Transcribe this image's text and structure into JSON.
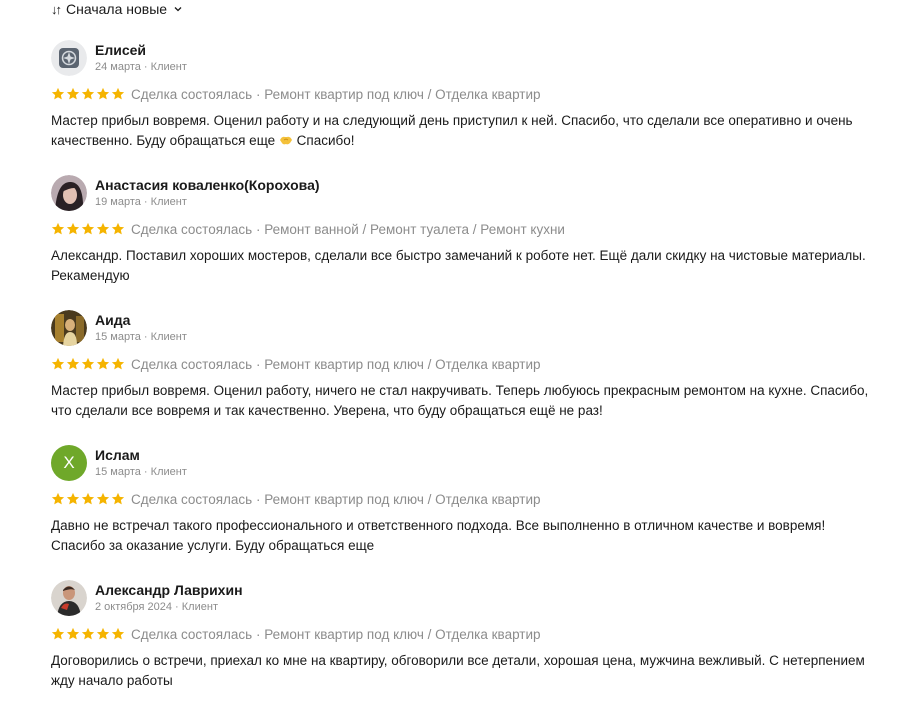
{
  "sort": {
    "icon": "sort-arrows-icon",
    "label": "Сначала новые",
    "chevron": "chevron-down-icon"
  },
  "colors": {
    "star": "#f5b400",
    "meta": "#8c8c8c",
    "avatar_letter_bg": "#6fa82a"
  },
  "reviews": [
    {
      "name": "Елисей",
      "meta": "24 марта · Клиент",
      "rating": 5,
      "tags": "Сделка состоялась · Ремонт квартир под ключ / Отделка квартир",
      "text_before": "Мастер прибыл вовремя. Оценил работу и на следующий день приступил к ней. Спасибо, что сделали все оперативно и очень качественно. Буду обращаться еще ",
      "emoji": "handshake-emoji",
      "text_after": " Спасибо!"
    },
    {
      "name": "Анастасия коваленко(Корохова)",
      "meta": "19 марта · Клиент",
      "rating": 5,
      "tags": "Сделка состоялась · Ремонт ванной / Ремонт туалета / Ремонт кухни",
      "text": "Александр. Поставил хороших мостеров, сделали все быстро замечаний к роботе нет. Ещё дали скидку на чистовые материалы. Рекамендую"
    },
    {
      "name": "Аида",
      "meta": "15 марта · Клиент",
      "rating": 5,
      "tags": "Сделка состоялась · Ремонт квартир под ключ / Отделка квартир",
      "text": "Мастер прибыл вовремя. Оценил работу, ничего не стал накручивать. Теперь любуюсь прекрасным ремонтом на кухне. Спасибо, что сделали все вовремя и так качественно. Уверена, что буду обращаться ещё не раз!"
    },
    {
      "name": "Ислам",
      "meta": "15 марта · Клиент",
      "avatar_letter": "Х",
      "rating": 5,
      "tags": "Сделка состоялась · Ремонт квартир под ключ / Отделка квартир",
      "text": "Давно не встречал такого профессионального и ответственного подхода. Все выполненно в отличном качестве и вовремя! Спасибо за оказание услуги. Буду обращаться еще"
    },
    {
      "name": "Александр Лаврихин",
      "meta": "2 октября 2024 · Клиент",
      "rating": 5,
      "tags": "Сделка состоялась · Ремонт квартир под ключ / Отделка квартир",
      "text": "Договорились о встречи, приехал ко мне на квартиру, обговорили все детали, хорошая цена, мужчина вежливый. С нетерпением жду начало работы"
    }
  ]
}
